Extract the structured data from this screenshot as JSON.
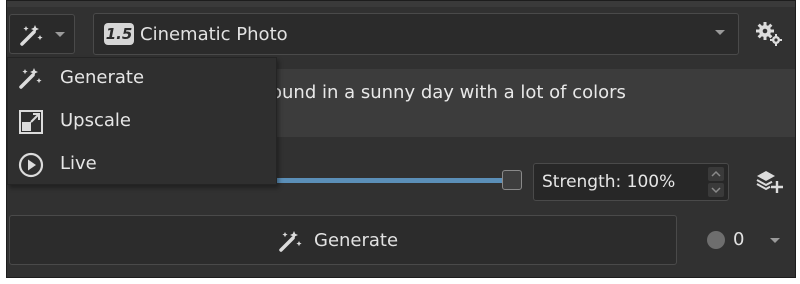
{
  "mode_button": {
    "icon": "magic-wand-icon",
    "chevron": "chevron-down-icon"
  },
  "style": {
    "version_badge": "1.5",
    "name": "Cinematic Photo"
  },
  "settings": {
    "icon": "gears-icon"
  },
  "prompt": {
    "text": "ound in a sunny day with a lot of colors"
  },
  "strength": {
    "label": "Strength: 100%",
    "value_percent": 100
  },
  "add_layer": {
    "icon": "add-layer-icon"
  },
  "generate": {
    "label": "Generate",
    "icon": "magic-wand-icon"
  },
  "queue": {
    "count": "0"
  },
  "mode_menu": {
    "items": [
      {
        "label": "Generate",
        "icon": "magic-wand-icon"
      },
      {
        "label": "Upscale",
        "icon": "upscale-icon"
      },
      {
        "label": "Live",
        "icon": "play-icon"
      }
    ]
  },
  "colors": {
    "panel_bg": "#313131",
    "prompt_bg": "#3c3c3c",
    "slider_fill": "#5b8fb8",
    "text": "#e2e2e2"
  }
}
